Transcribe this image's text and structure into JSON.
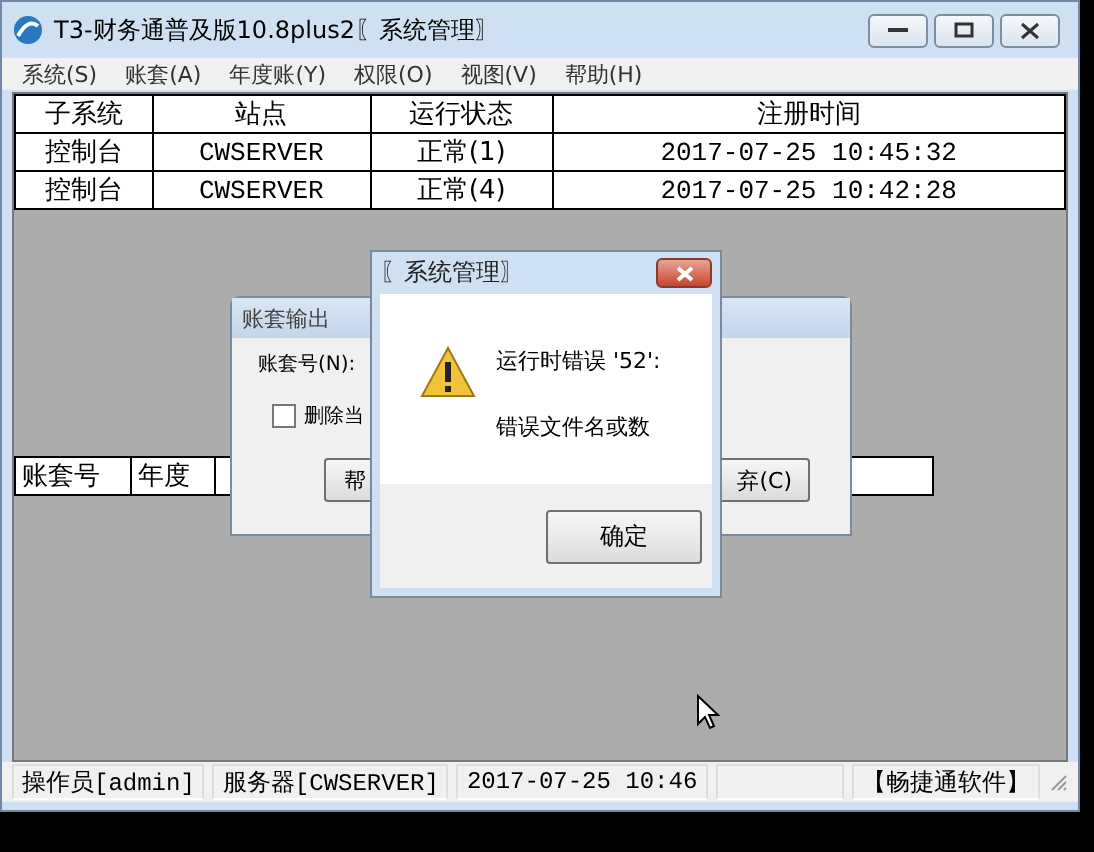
{
  "window": {
    "title": "T3-财务通普及版10.8plus2〖系统管理〗"
  },
  "menu": [
    "系统(S)",
    "账套(A)",
    "年度账(Y)",
    "权限(O)",
    "视图(V)",
    "帮助(H)"
  ],
  "table": {
    "columns": [
      "子系统",
      "站点",
      "运行状态",
      "注册时间"
    ],
    "rows": [
      [
        "控制台",
        "CWSERVER",
        "正常(1)",
        "2017-07-25 10:45:32"
      ],
      [
        "控制台",
        "CWSERVER",
        "正常(4)",
        "2017-07-25 10:42:28"
      ]
    ]
  },
  "lower_table": {
    "columns": [
      "账套号",
      "年度"
    ]
  },
  "export_dialog": {
    "title": "账套输出",
    "account_label": "账套号(N):",
    "checkbox": {
      "label": "删除当",
      "checked": false
    },
    "buttons": [
      "帮",
      "弃(C)"
    ]
  },
  "error_dialog": {
    "title": "〖系统管理〗",
    "message": "运行时错误 '52':",
    "detail": "错误文件名或数",
    "button": "确定"
  },
  "status_bar": [
    "操作员[admin]",
    "服务器[CWSERVER]",
    "2017-07-25 10:46",
    "【畅捷通软件】"
  ]
}
